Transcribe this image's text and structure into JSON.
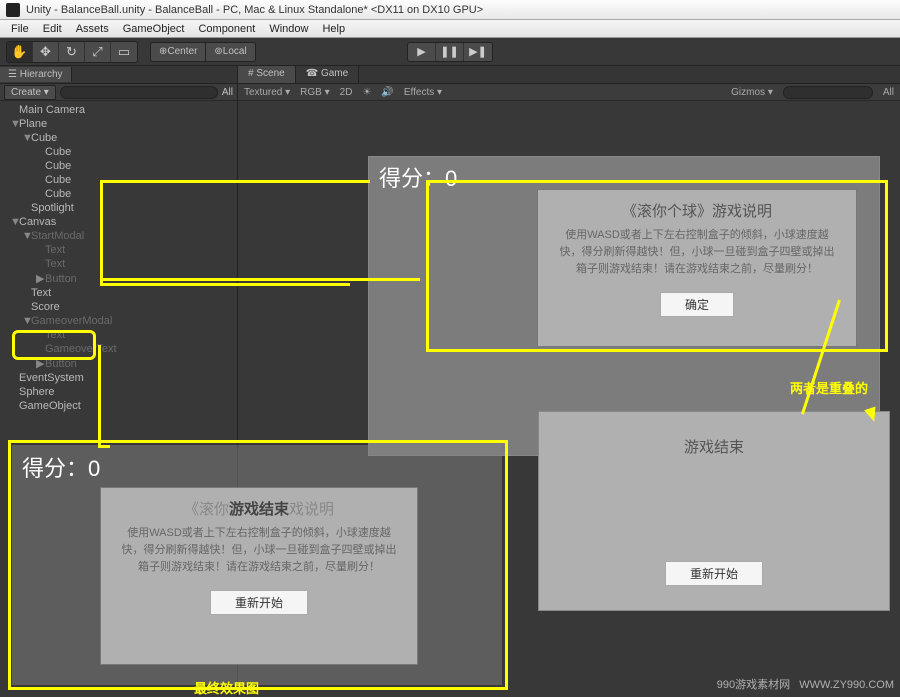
{
  "window": {
    "title": "Unity - BalanceBall.unity - BalanceBall - PC, Mac & Linux Standalone* <DX11 on DX10 GPU>"
  },
  "menu": {
    "items": [
      "File",
      "Edit",
      "Assets",
      "GameObject",
      "Component",
      "Window",
      "Help"
    ]
  },
  "toolbar": {
    "center": "Center",
    "local": "Local"
  },
  "hierarchy": {
    "tab": "Hierarchy",
    "create": "Create",
    "q_all": "All",
    "items": [
      {
        "label": "Main Camera",
        "depth": 0
      },
      {
        "label": "Plane",
        "depth": 0,
        "arrow": "▼"
      },
      {
        "label": "Cube",
        "depth": 1,
        "arrow": "▼"
      },
      {
        "label": "Cube",
        "depth": 2
      },
      {
        "label": "Cube",
        "depth": 2
      },
      {
        "label": "Cube",
        "depth": 2
      },
      {
        "label": "Cube",
        "depth": 2
      },
      {
        "label": "Spotlight",
        "depth": 1
      },
      {
        "label": "Canvas",
        "depth": 0,
        "arrow": "▼"
      },
      {
        "label": "StartModal",
        "depth": 1,
        "arrow": "▼",
        "dim": true
      },
      {
        "label": "Text",
        "depth": 2,
        "dim": true
      },
      {
        "label": "Text",
        "depth": 2,
        "dim": true
      },
      {
        "label": "Button",
        "depth": 2,
        "arrow": "▶",
        "dim": true
      },
      {
        "label": "Text",
        "depth": 1
      },
      {
        "label": "Score",
        "depth": 1
      },
      {
        "label": "GameoverModal",
        "depth": 1,
        "arrow": "▼",
        "dim": true
      },
      {
        "label": "Text",
        "depth": 2,
        "dim": true
      },
      {
        "label": "GameoverText",
        "depth": 2,
        "dim": true
      },
      {
        "label": "Button",
        "depth": 2,
        "arrow": "▶",
        "dim": true
      },
      {
        "label": "EventSystem",
        "depth": 0
      },
      {
        "label": "Sphere",
        "depth": 0
      },
      {
        "label": "GameObject",
        "depth": 0
      }
    ]
  },
  "scene": {
    "tabs": {
      "scene": "Scene",
      "game": "Game"
    },
    "opts": {
      "textured": "Textured",
      "rgb": "RGB",
      "twod": "2D",
      "effects": "Effects",
      "gizmos": "Gizmos",
      "q_all": "All"
    }
  },
  "ui": {
    "score1": "得分：0",
    "score2": "得分：0",
    "startModal": {
      "title": "《滚你个球》游戏说明",
      "body": "使用WASD或者上下左右控制盒子的倾斜，小球速度越快，得分刷新得越快！但，小球一旦碰到盒子四壁或掉出箱子则游戏结束！请在游戏结束之前，尽量刷分！",
      "button": "确定"
    },
    "gameoverModal": {
      "title": "游戏结束",
      "button": "重新开始"
    },
    "mergedModal": {
      "title_pre": "《滚你",
      "title_mid": "游戏结束",
      "title_post": "戏说明",
      "body": "使用WASD或者上下左右控制盒子的倾斜，小球速度越快，得分刷新得越快！但，小球一旦碰到盒子四壁或掉出箱子则游戏结束！请在游戏结束之前，尽量刷分！",
      "button": "重新开始"
    }
  },
  "annotations": {
    "overlap": "两者是重叠的",
    "final": "最终效果图"
  },
  "watermark": "WWW.ZY990.COM",
  "watermark2": "990游戏素材网"
}
